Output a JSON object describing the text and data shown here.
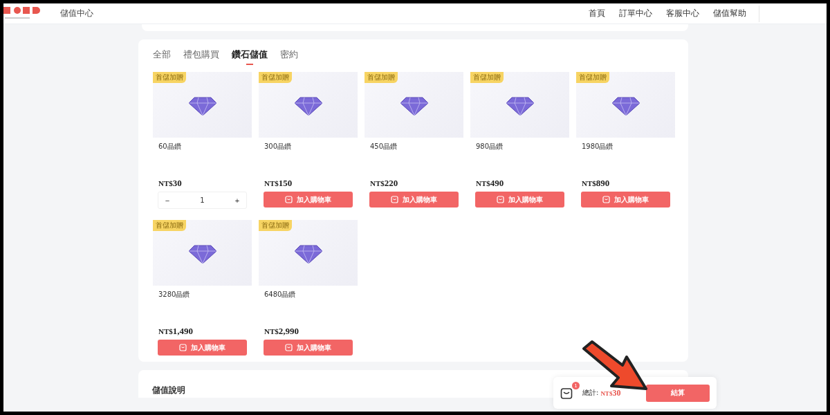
{
  "header": {
    "title": "儲值中心",
    "nav": [
      "首頁",
      "訂單中心",
      "客服中心",
      "儲值幫助"
    ]
  },
  "tabs": [
    {
      "label": "全部",
      "selected": false
    },
    {
      "label": "禮包購買",
      "selected": false
    },
    {
      "label": "鑽石儲值",
      "selected": true
    },
    {
      "label": "密約",
      "selected": false
    }
  ],
  "products": [
    {
      "badge": "首儲加贈",
      "name": "60晶鑽",
      "currency": "NT$",
      "price": "30",
      "kind": "stepper",
      "minus": "−",
      "quantity": "1",
      "plus": "+"
    },
    {
      "badge": "首儲加贈",
      "name": "300晶鑽",
      "currency": "NT$",
      "price": "150",
      "kind": "button",
      "button": "加入購物車"
    },
    {
      "badge": "首儲加贈",
      "name": "450晶鑽",
      "currency": "NT$",
      "price": "220",
      "kind": "button",
      "button": "加入購物車"
    },
    {
      "badge": "首儲加贈",
      "name": "980晶鑽",
      "currency": "NT$",
      "price": "490",
      "kind": "button",
      "button": "加入購物車"
    },
    {
      "badge": "首儲加贈",
      "name": "1980晶鑽",
      "currency": "NT$",
      "price": "890",
      "kind": "button",
      "button": "加入購物車"
    },
    {
      "badge": "首儲加贈",
      "name": "3280晶鑽",
      "currency": "NT$",
      "price": "1,490",
      "kind": "button",
      "button": "加入購物車"
    },
    {
      "badge": "首儲加贈",
      "name": "6480晶鑽",
      "currency": "NT$",
      "price": "2,990",
      "kind": "button",
      "button": "加入購物車"
    }
  ],
  "info_section": {
    "title": "儲值說明"
  },
  "cart_bar": {
    "count": "1",
    "total_label": "總計:",
    "currency": "NT$",
    "total": "30",
    "checkout": "結算"
  }
}
